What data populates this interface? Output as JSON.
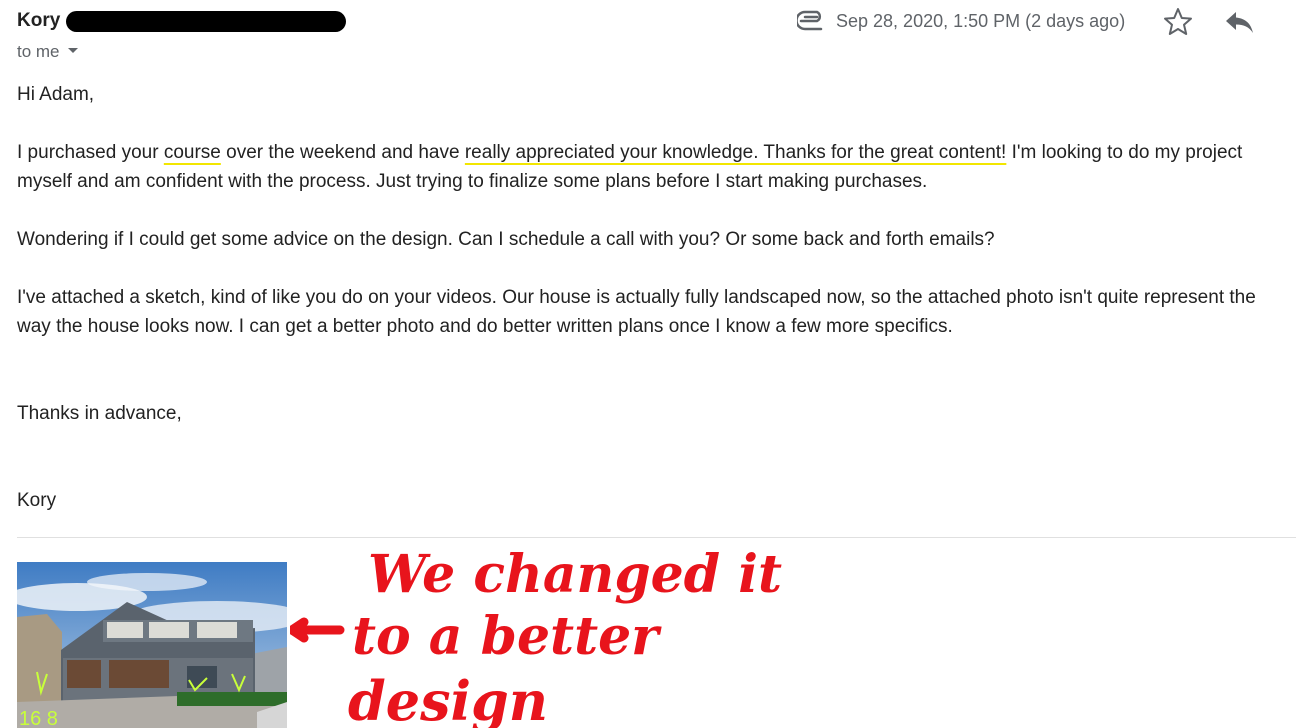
{
  "email": {
    "sender": "Kory",
    "recipient": "to me",
    "date": "Sep 28, 2020, 1:50 PM (2 days ago)",
    "body": {
      "greeting": "Hi Adam,",
      "p1_a": "I purchased your ",
      "p1_hl1": "course",
      "p1_b": " over the weekend and have ",
      "p1_hl2": "really appreciated your knowledge.  Thanks for the great content!",
      "p1_c": "  I'm looking to do my project",
      "p1_line2": "myself and am confident with the process.  Just trying to finalize some plans before I start making purchases.",
      "p2": "Wondering if I could get some advice on the design.  Can I schedule a call with you?  Or some back and forth emails?",
      "p3_line1": "I've attached a sketch, kind of like you do on your videos.  Our house is actually fully landscaped now, so the attached photo isn't quite represent the",
      "p3_line2": "way the house looks now.  I can get a better photo and do better written plans once I know a few more specifics.",
      "closing": "Thanks in advance,",
      "signature": "Kory"
    },
    "annotation": {
      "line1": "We changed it",
      "line2": "to a better",
      "line3": "design",
      "color": "#e8141c"
    },
    "thumbnail_marks": "16 8"
  },
  "icons": {
    "attachment": "paperclip-icon",
    "star": "star-icon",
    "reply": "reply-arrow-icon"
  },
  "colors": {
    "highlight_underline": "#f2e600",
    "meta_gray": "#5f6368"
  }
}
